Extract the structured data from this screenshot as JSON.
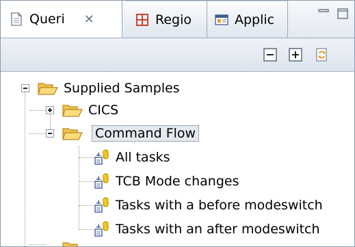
{
  "tabs": [
    {
      "label": "Queri",
      "active": true
    },
    {
      "label": "Regio",
      "active": false
    },
    {
      "label": "Applic",
      "active": false
    }
  ],
  "tree": {
    "root": "Supplied Samples",
    "nodes": [
      {
        "label": "CICS",
        "expanded": false
      },
      {
        "label": "Command Flow",
        "expanded": true,
        "selected": true
      }
    ],
    "queries": [
      "All tasks",
      "TCB Mode changes",
      "Tasks with a before modeswitch",
      "Tasks with an after modeswitch"
    ]
  },
  "colors": {
    "accent": "#e8a23a",
    "folder": "#f4c24a",
    "query_icon": "#3f5e96",
    "selection": "#e4e9f0"
  },
  "icons": {
    "queries_tab": "document-icon",
    "regio_tab": "grid-icon",
    "applic_tab": "window-icon",
    "close": "close-icon",
    "minimize": "minimize-icon",
    "maximize": "maximize-icon",
    "collapse_all": "collapse-all-icon",
    "expand_all": "expand-all-icon",
    "sync": "sync-icon",
    "folder": "folder-icon",
    "query": "query-icon"
  }
}
